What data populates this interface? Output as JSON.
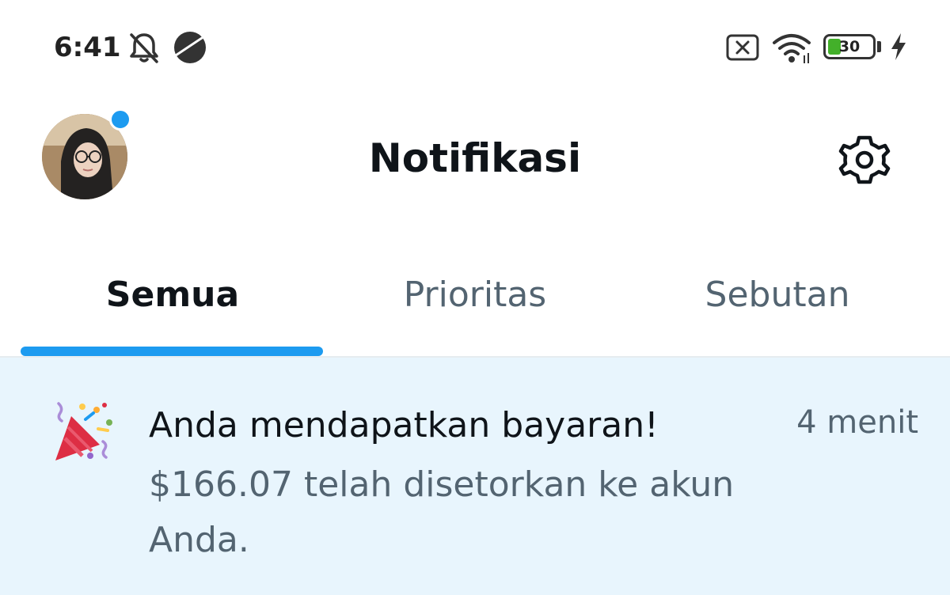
{
  "status_bar": {
    "time": "6:41",
    "battery_level": "30",
    "battery_fraction": 0.3,
    "icons": [
      "bell-off-icon",
      "planet-icon",
      "no-sim-icon",
      "wifi-icon",
      "battery-icon",
      "charging-icon"
    ]
  },
  "header": {
    "title": "Notifikasi",
    "avatar_has_unread_dot": true,
    "settings_icon": "gear-icon"
  },
  "tabs": [
    {
      "label": "Semua",
      "active": true
    },
    {
      "label": "Prioritas",
      "active": false
    },
    {
      "label": "Sebutan",
      "active": false
    }
  ],
  "notifications": [
    {
      "icon": "party-popper-icon",
      "title": "Anda mendapatkan bayaran!",
      "time": "4 menit",
      "body": "$166.07 telah disetorkan ke akun Anda."
    }
  ],
  "colors": {
    "accent": "#1d9bf0",
    "notification_bg": "#e8f5fd",
    "secondary_text": "#536471",
    "primary_text": "#0f1419"
  }
}
